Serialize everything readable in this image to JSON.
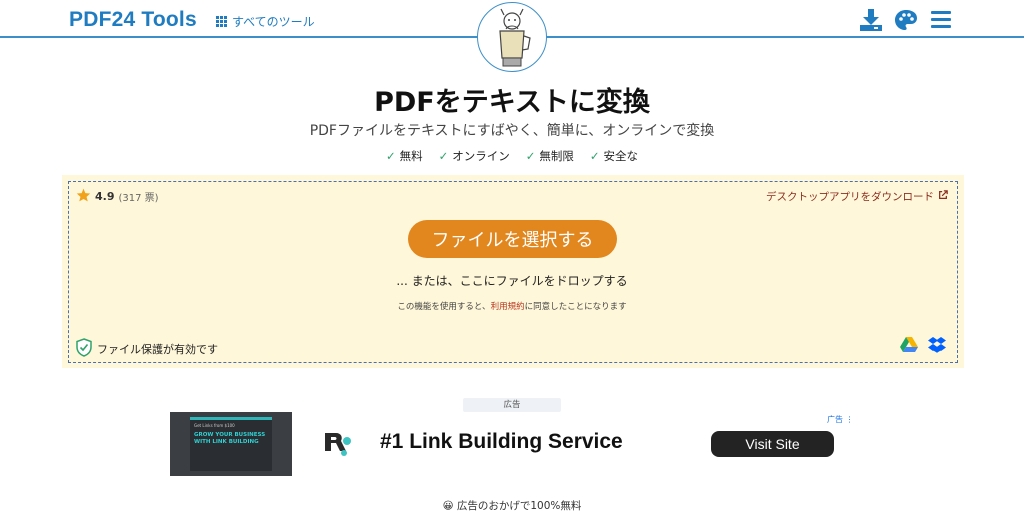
{
  "header": {
    "logo_text": "PDF24 Tools",
    "all_tools_label": "すべてのツール",
    "icons": [
      "grid-icon",
      "download-icon",
      "palette-icon",
      "menu-icon"
    ]
  },
  "main": {
    "title": "PDFをテキストに変換",
    "subtitle": "PDFファイルをテキストにすばやく、簡単に、オンラインで変換",
    "features": [
      "無料",
      "オンライン",
      "無制限",
      "安全な"
    ]
  },
  "upload": {
    "rating_value": "4.9",
    "rating_votes": "(317 票)",
    "desktop_link": "デスクトップアプリをダウンロード",
    "select_button": "ファイルを選択する",
    "drop_text": "... または、ここにファイルをドロップする",
    "terms_prefix": "この機能を使用すると、",
    "terms_link": "利用規約",
    "terms_suffix": "に同意したことになります",
    "protection_label": "ファイル保護が有効です",
    "colors": {
      "background": "#fff7d9",
      "button": "#e2861e",
      "border": "#4a6fae"
    }
  },
  "ad": {
    "label": "広告",
    "image_small_text": "Get Links from $100",
    "image_big_text": "GROW YOUR BUSINESS WITH LINK BUILDING",
    "headline": "#1 Link Building Service",
    "button": "Visit Site",
    "choice_label": "广告"
  },
  "footer": {
    "free_note": "広告のおかげで100%無料"
  },
  "colors": {
    "brand": "#1f7cc1",
    "check": "#2fa36b"
  }
}
